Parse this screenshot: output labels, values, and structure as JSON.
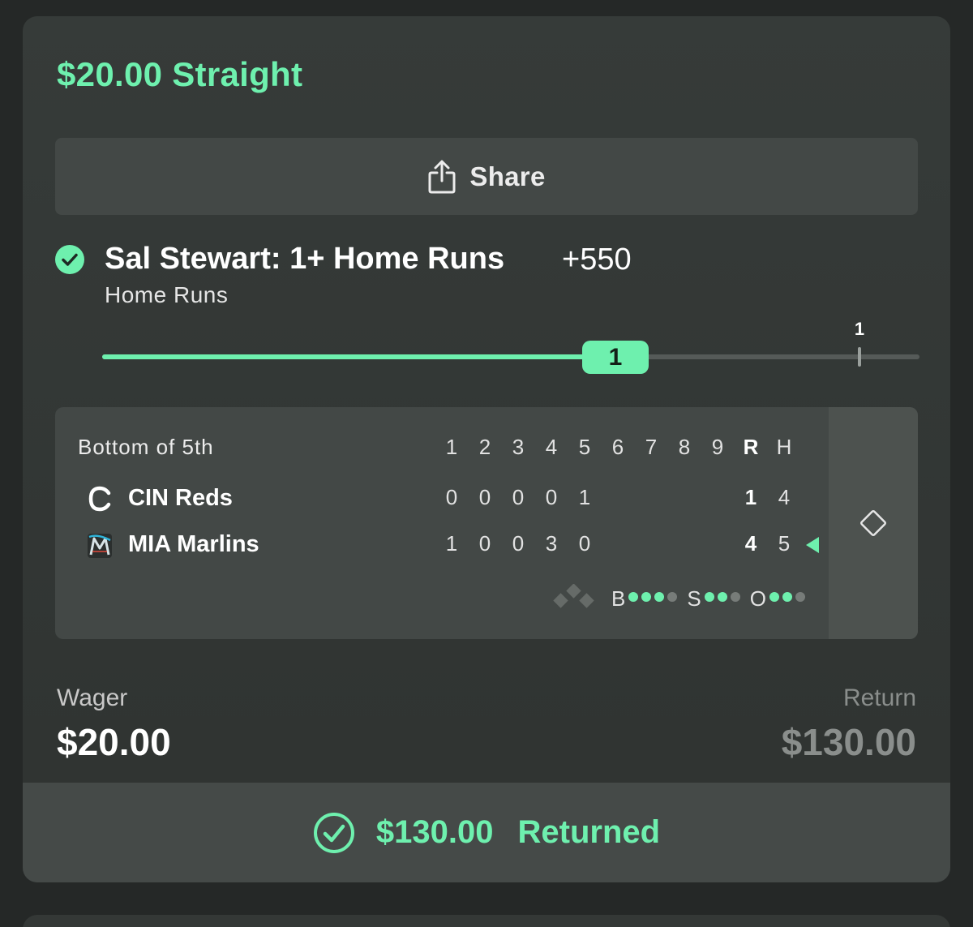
{
  "bet": {
    "title": "$20.00 Straight",
    "share_label": "Share",
    "accent": "#6ef0ae"
  },
  "leg": {
    "status_icon": "check-circle-icon",
    "title": "Sal Stewart: 1+ Home Runs",
    "odds": "+550",
    "market": "Home Runs",
    "progress_value": "1",
    "target_value": "1",
    "progress_fraction": 0.63
  },
  "scoreboard": {
    "status": "Bottom of 5th",
    "columns": [
      "1",
      "2",
      "3",
      "4",
      "5",
      "6",
      "7",
      "8",
      "9",
      "R",
      "H"
    ],
    "teams": [
      {
        "logo": "reds-logo-icon",
        "name": "CIN Reds",
        "innings": [
          "0",
          "0",
          "0",
          "0",
          "1",
          "",
          "",
          "",
          ""
        ],
        "runs": "1",
        "hits": "4",
        "batting": false
      },
      {
        "logo": "marlins-logo-icon",
        "name": "MIA Marlins",
        "innings": [
          "1",
          "0",
          "0",
          "3",
          "0",
          "",
          "",
          "",
          ""
        ],
        "runs": "4",
        "hits": "5",
        "batting": true
      }
    ],
    "count": {
      "balls_label": "B",
      "balls": 3,
      "balls_max": 4,
      "strikes_label": "S",
      "strikes": 2,
      "strikes_max": 3,
      "outs_label": "O",
      "outs": 2,
      "outs_max": 3
    },
    "side_icon": "diamond-field-icon"
  },
  "wager": {
    "label": "Wager",
    "value": "$20.00"
  },
  "return": {
    "label": "Return",
    "value": "$130.00"
  },
  "settlement": {
    "amount": "$130.00",
    "text": "Returned",
    "icon": "check-circle-icon"
  }
}
